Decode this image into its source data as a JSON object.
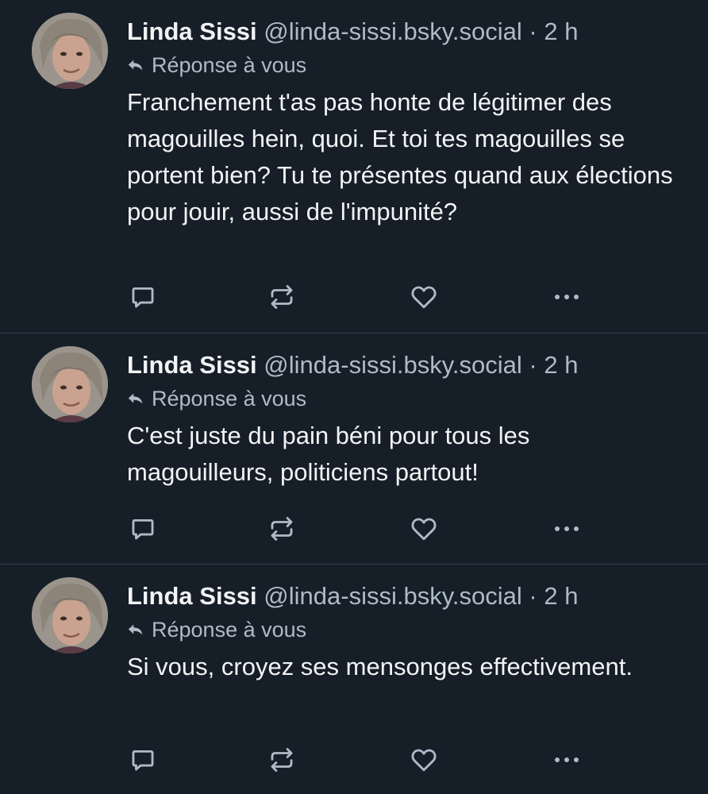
{
  "posts": [
    {
      "author_name": "Linda Sissi",
      "handle": "@linda-sissi.bsky.social",
      "separator": "·",
      "time": "2 h",
      "reply_context": "Réponse à vous",
      "text": "Franchement t'as pas honte de légitimer des magouilles hein, quoi. Et toi tes magouilles se portent bien? Tu te présentes quand aux élections pour jouir, aussi de l'impunité?",
      "icons": [
        "reply-icon",
        "repost-icon",
        "like-icon",
        "more-icon"
      ]
    },
    {
      "author_name": "Linda Sissi",
      "handle": "@linda-sissi.bsky.social",
      "separator": "·",
      "time": "2 h",
      "reply_context": "Réponse à vous",
      "text": "C'est juste du pain béni pour tous les magouilleurs, politiciens partout!",
      "icons": [
        "reply-icon",
        "repost-icon",
        "like-icon",
        "more-icon"
      ]
    },
    {
      "author_name": "Linda Sissi",
      "handle": "@linda-sissi.bsky.social",
      "separator": "·",
      "time": "2 h",
      "reply_context": "Réponse à vous",
      "text": "Si vous, croyez ses mensonges effectivement.",
      "icons": [
        "reply-icon",
        "repost-icon",
        "like-icon",
        "more-icon"
      ]
    }
  ],
  "colors": {
    "background": "#161e27",
    "text": "#f1f3f5",
    "muted": "#aebbc9",
    "divider": "#2e4052"
  }
}
